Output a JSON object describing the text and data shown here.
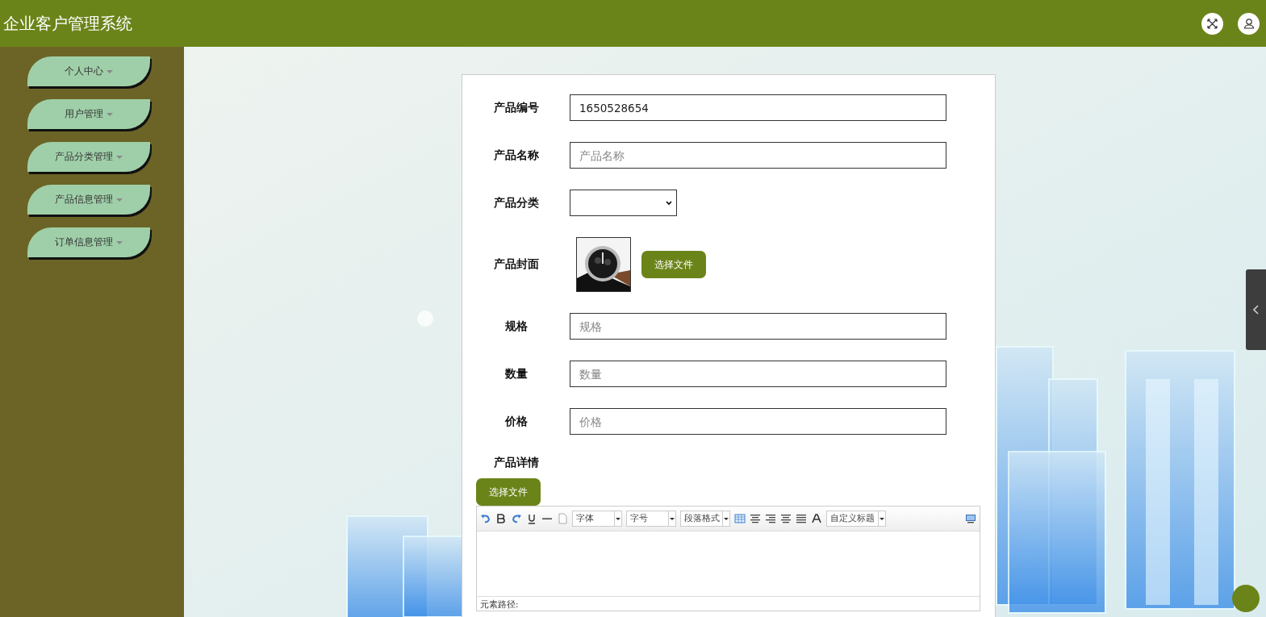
{
  "header": {
    "title": "企业客户管理系统"
  },
  "sidebar": {
    "items": [
      {
        "label": "个人中心"
      },
      {
        "label": "用户管理"
      },
      {
        "label": "产品分类管理"
      },
      {
        "label": "产品信息管理"
      },
      {
        "label": "订单信息管理"
      }
    ]
  },
  "form": {
    "fields": [
      {
        "kind": "text",
        "label": "产品编号",
        "value": "1650528654"
      },
      {
        "kind": "text",
        "label": "产品名称",
        "placeholder": "产品名称"
      },
      {
        "kind": "select",
        "label": "产品分类"
      },
      {
        "label": "产品封面",
        "button": "选择文件"
      },
      {
        "kind": "text",
        "label": "规格",
        "placeholder": "规格"
      },
      {
        "kind": "text",
        "label": "数量",
        "placeholder": "数量"
      },
      {
        "kind": "text",
        "label": "价格",
        "placeholder": "价格"
      },
      {
        "kind": "heading",
        "label": "产品详情"
      }
    ],
    "upload_button": "选择文件",
    "editor": {
      "dropdowns": [
        "字体",
        "字号",
        "段落格式"
      ],
      "heading_dropdown": "自定义标题",
      "footer": "元素路径:"
    }
  }
}
